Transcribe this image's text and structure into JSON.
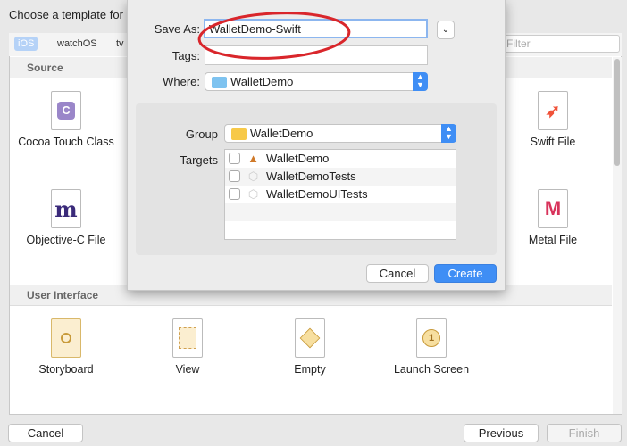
{
  "window": {
    "title": "Choose a template for"
  },
  "platform_tabs": [
    {
      "label": "iOS",
      "selected": true
    },
    {
      "label": "watchOS"
    },
    {
      "label": "tv"
    }
  ],
  "filter": {
    "placeholder": "Filter"
  },
  "sections": [
    {
      "title": "Source",
      "items": [
        {
          "label": "Cocoa Touch Class",
          "icon": "cocoa-touch-class-icon",
          "glyph": "C"
        },
        {
          "label": "Objective-C File",
          "icon": "objective-c-file-icon",
          "glyph": "m"
        },
        {
          "label": "Swift File",
          "icon": "swift-file-icon",
          "glyph": "➶"
        },
        {
          "label": "Metal File",
          "icon": "metal-file-icon",
          "glyph": "M"
        }
      ]
    },
    {
      "title": "User Interface",
      "items": [
        {
          "label": "Storyboard",
          "icon": "storyboard-icon"
        },
        {
          "label": "View",
          "icon": "view-icon"
        },
        {
          "label": "Empty",
          "icon": "empty-icon"
        },
        {
          "label": "Launch Screen",
          "icon": "launch-screen-icon",
          "glyph": "1"
        }
      ]
    }
  ],
  "footer": {
    "cancel": "Cancel",
    "previous": "Previous",
    "finish": "Finish"
  },
  "sheet": {
    "save_as_label": "Save As:",
    "save_as_value": "WalletDemo-Swift",
    "tags_label": "Tags:",
    "tags_value": "",
    "where_label": "Where:",
    "where_value": "WalletDemo",
    "group_label": "Group",
    "group_value": "WalletDemo",
    "targets_label": "Targets",
    "targets": [
      {
        "name": "WalletDemo",
        "checked": false,
        "icon": "app-target-icon"
      },
      {
        "name": "WalletDemoTests",
        "checked": false,
        "icon": "test-target-icon"
      },
      {
        "name": "WalletDemoUITests",
        "checked": false,
        "icon": "test-target-icon"
      }
    ],
    "cancel": "Cancel",
    "create": "Create"
  },
  "colors": {
    "accent": "#3f8ef5",
    "annotation": "#d9262b"
  }
}
